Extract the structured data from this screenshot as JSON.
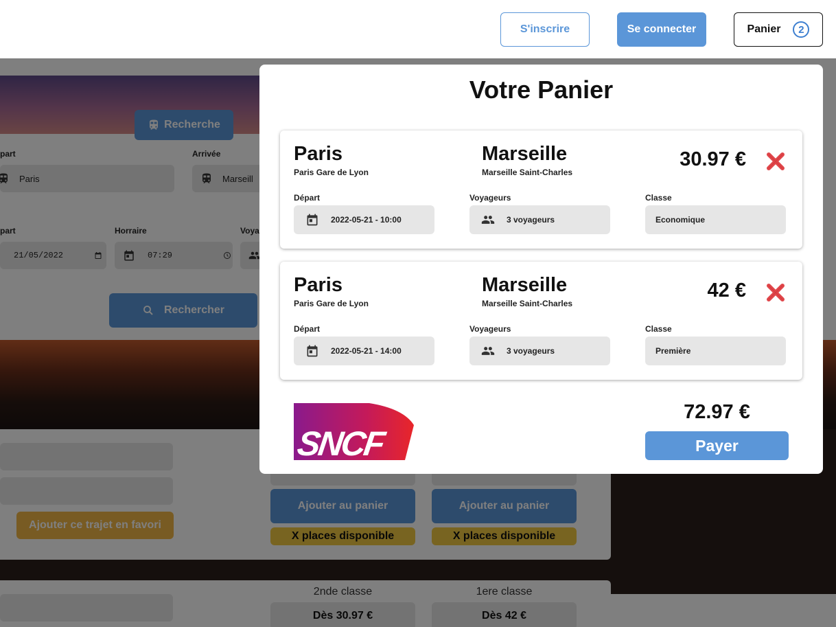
{
  "header": {
    "signup_label": "S'inscrire",
    "login_label": "Se connecter",
    "cart_label": "Panier",
    "cart_count": "2"
  },
  "background": {
    "search_tab_label": "Recherche",
    "depart_label": "part",
    "arrivee_label": "Arrivée",
    "depart_value": "Paris",
    "arrivee_value": "Marseill",
    "date_label": "part",
    "horaire_label": "Horraire",
    "voyageurs_label": "Voya",
    "date_value": "21/05/2022",
    "time_value": "07:29",
    "search_button": "Rechercher",
    "fav_button": "Ajouter ce trajet en favori",
    "add_to_cart": "Ajouter au panier",
    "places_available": "X places disponible",
    "second_class": "2nde classe",
    "first_class": "1ere classe",
    "second_price": "Dès 30.97 €",
    "first_price": "Dès 42 €"
  },
  "modal": {
    "title": "Votre Panier",
    "labels": {
      "depart": "Départ",
      "voyageurs": "Voyageurs",
      "classe": "Classe"
    },
    "trips": [
      {
        "from_city": "Paris",
        "from_station": "Paris Gare de Lyon",
        "to_city": "Marseille",
        "to_station": "Marseille Saint-Charles",
        "price": "30.97 €",
        "datetime": "2022-05-21 - 10:00",
        "travelers": "3 voyageurs",
        "class": "Economique"
      },
      {
        "from_city": "Paris",
        "from_station": "Paris Gare de Lyon",
        "to_city": "Marseille",
        "to_station": "Marseille Saint-Charles",
        "price": "42 €",
        "datetime": "2022-05-21 - 14:00",
        "travelers": "3 voyageurs",
        "class": "Première"
      }
    ],
    "total": "72.97 €",
    "pay_label": "Payer",
    "logo_text": "SNCF"
  },
  "colors": {
    "accent": "#5b96d8",
    "delete": "#e0464a",
    "yellow": "#f0c842",
    "orange": "#f0b646"
  }
}
